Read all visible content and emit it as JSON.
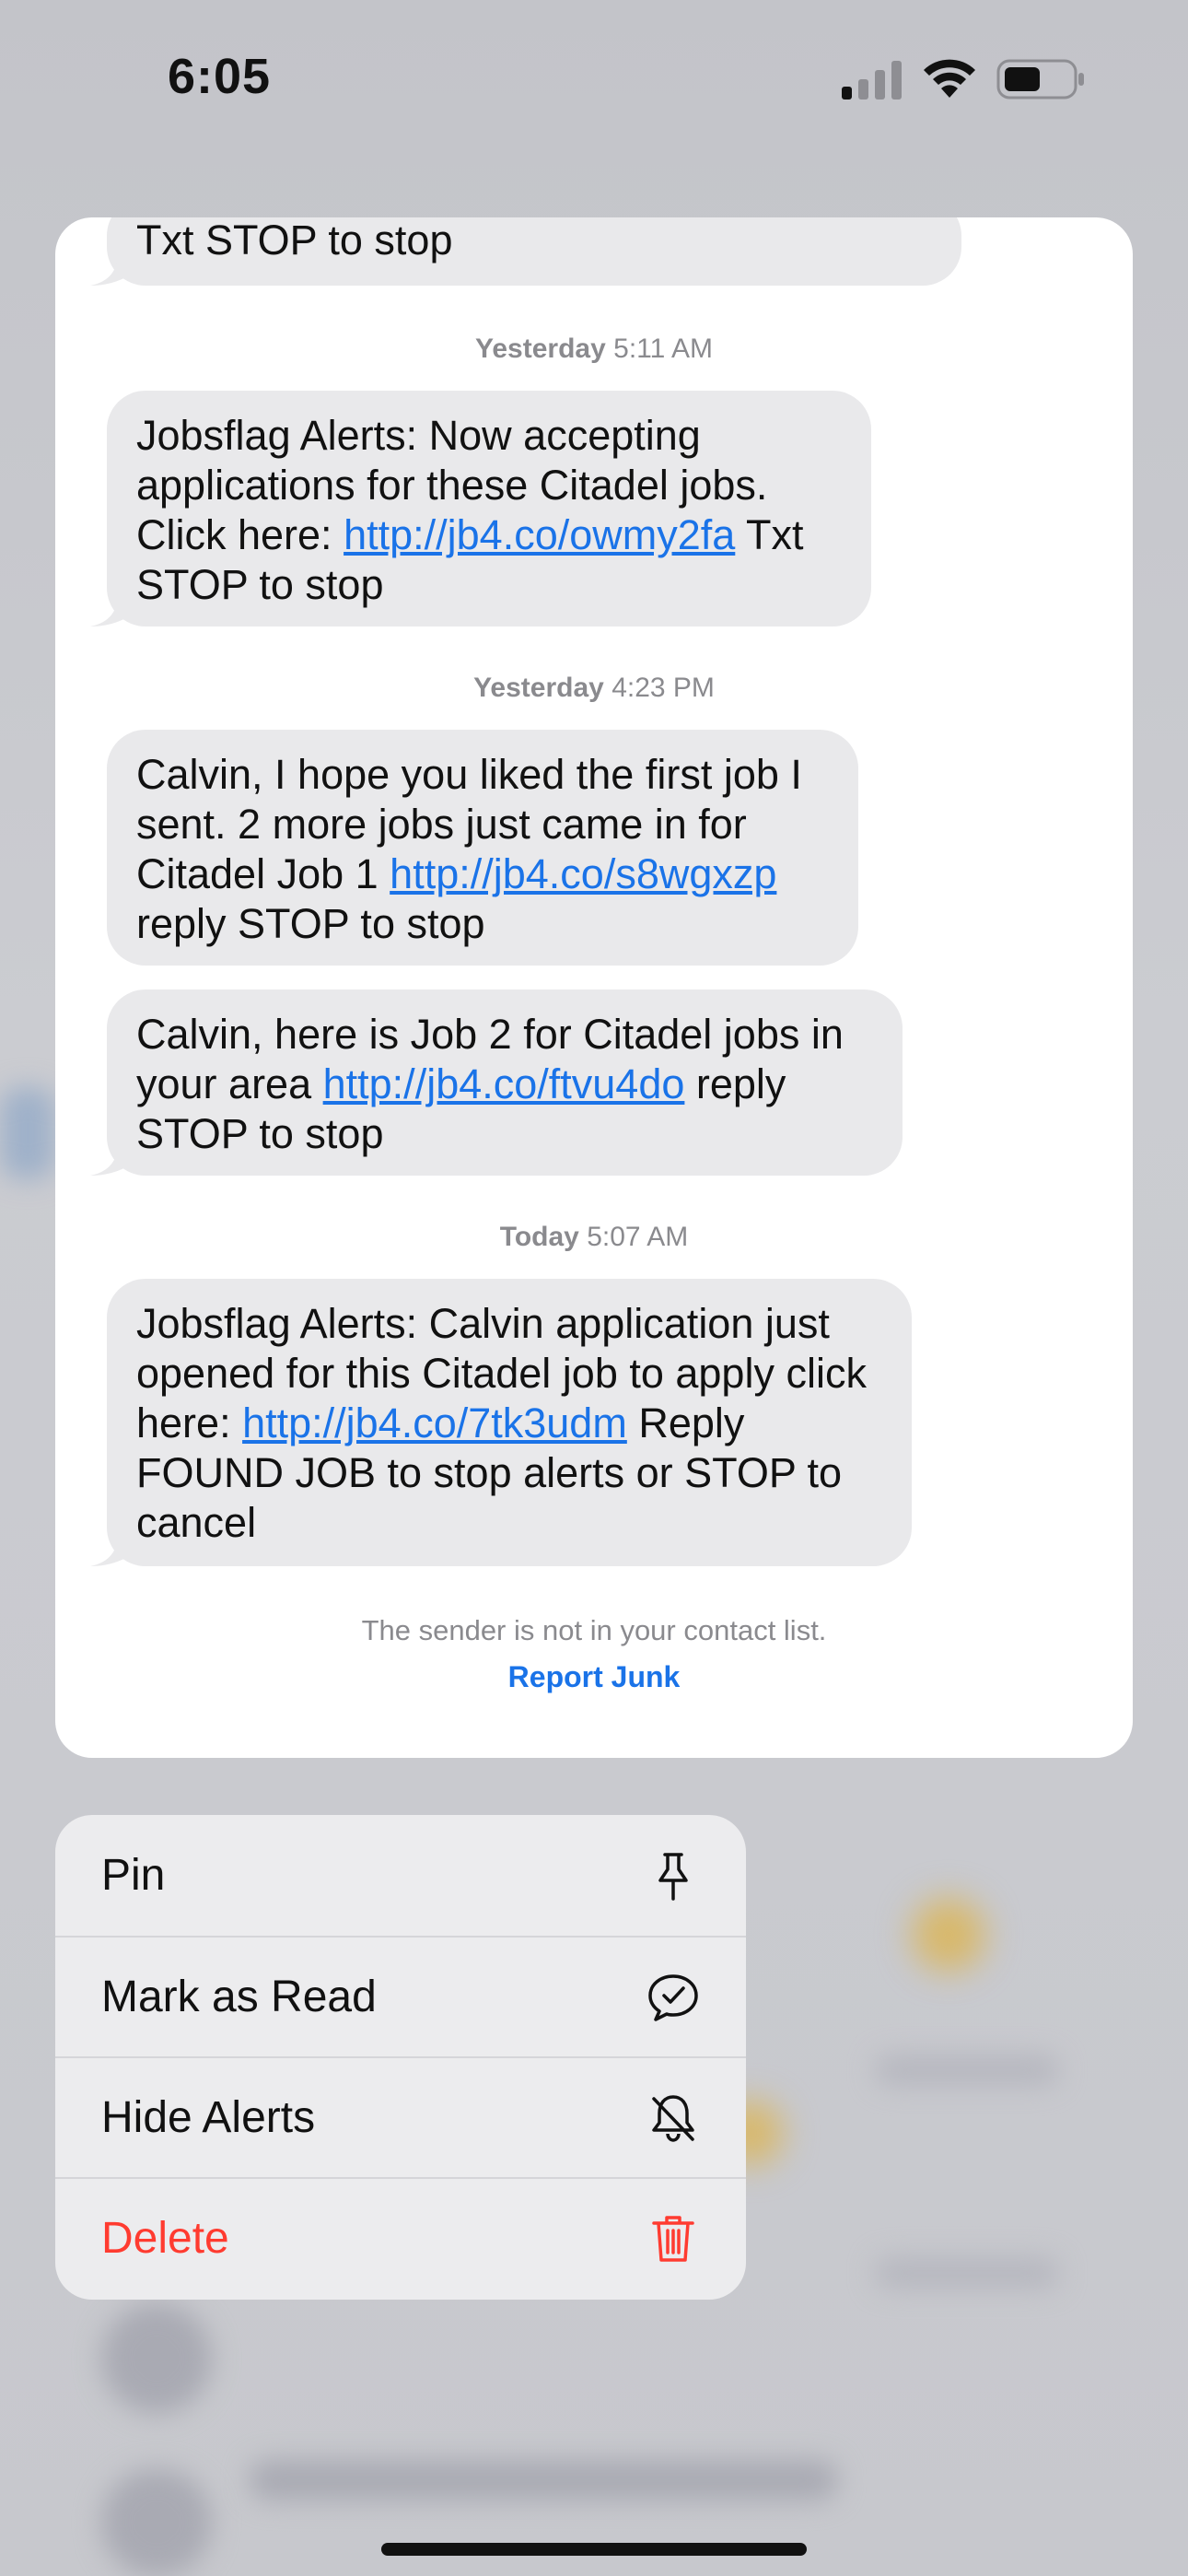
{
  "status_bar": {
    "time": "6:05"
  },
  "conversation": {
    "messages": [
      {
        "text_parts": [
          "Txt STOP to stop"
        ]
      },
      {
        "timestamp_day": "Yesterday",
        "timestamp_time": "5:11 AM"
      },
      {
        "text_before": "Jobsflag Alerts: Now accepting applications for these Citadel jobs. Click here: ",
        "link": "http://jb4.co/owmy2fa",
        "text_after": " Txt STOP to stop"
      },
      {
        "timestamp_day": "Yesterday",
        "timestamp_time": "4:23 PM"
      },
      {
        "text_before": "Calvin, I hope you liked the first job I sent. 2 more jobs just came in for Citadel Job 1 ",
        "link": "http://jb4.co/s8wgxzp",
        "text_after": " reply STOP to stop"
      },
      {
        "text_before": "Calvin, here is Job 2 for Citadel jobs in your area ",
        "link": "http://jb4.co/ftvu4do",
        "text_after": " reply STOP to stop"
      },
      {
        "timestamp_day": "Today",
        "timestamp_time": "5:07 AM"
      },
      {
        "text_before": "Jobsflag Alerts: Calvin application just opened for this Citadel job to apply click here: ",
        "link": "http://jb4.co/7tk3udm",
        "text_after": " Reply FOUND JOB to stop alerts or STOP to cancel"
      }
    ],
    "footer_note": "The sender is not in your contact list.",
    "report_junk_label": "Report Junk"
  },
  "context_menu": {
    "items": [
      {
        "label": "Pin",
        "icon": "pin-icon"
      },
      {
        "label": "Mark as Read",
        "icon": "speech-bubble-check-icon"
      },
      {
        "label": "Hide Alerts",
        "icon": "bell-slash-icon"
      },
      {
        "label": "Delete",
        "icon": "trash-icon",
        "color": "#ff3b30"
      }
    ]
  },
  "colors": {
    "link": "#1a73e8",
    "bubble": "#e9e9eb",
    "destructive": "#ff3b30"
  }
}
